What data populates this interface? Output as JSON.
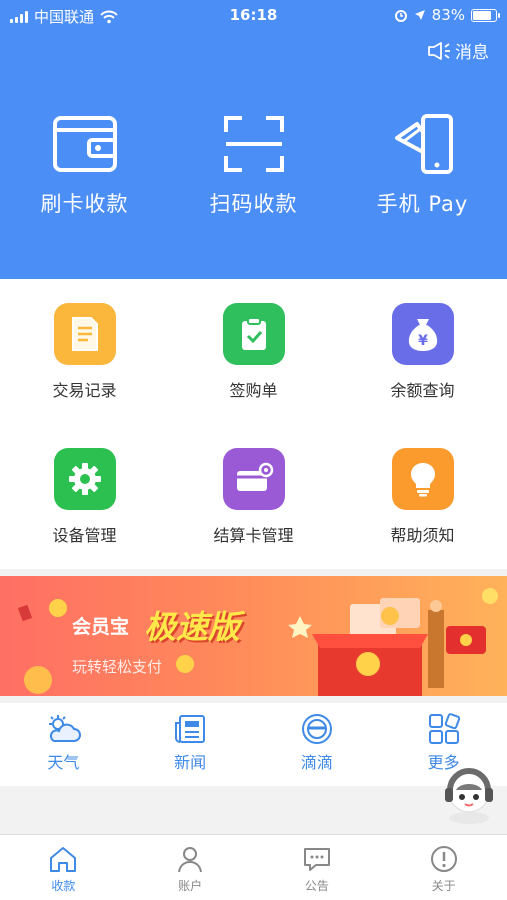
{
  "status_bar": {
    "carrier": "中国联通",
    "time": "16:18",
    "battery": "83%"
  },
  "header": {
    "message_label": "消息"
  },
  "hero_actions": [
    {
      "label": "刷卡收款",
      "icon": "wallet-icon"
    },
    {
      "label": "扫码收款",
      "icon": "scan-icon"
    },
    {
      "label": "手机 Pay",
      "icon": "phone-pay-icon"
    }
  ],
  "grid": [
    {
      "label": "交易记录",
      "icon": "document-icon",
      "color": "#fbb63c"
    },
    {
      "label": "签购单",
      "icon": "clipboard-check-icon",
      "color": "#2fbf5c"
    },
    {
      "label": "余额查询",
      "icon": "money-bag-icon",
      "color": "#6a6de8"
    },
    {
      "label": "设备管理",
      "icon": "gear-icon",
      "color": "#2bc04f"
    },
    {
      "label": "结算卡管理",
      "icon": "card-settings-icon",
      "color": "#9a5ad6"
    },
    {
      "label": "帮助须知",
      "icon": "lightbulb-icon",
      "color": "#fb9a2d"
    }
  ],
  "banner": {
    "brand": "会员宝",
    "highlight": "极速版",
    "subtitle": "玩转轻松支付"
  },
  "quick_links": [
    {
      "label": "天气",
      "icon": "weather-icon"
    },
    {
      "label": "新闻",
      "icon": "news-icon"
    },
    {
      "label": "滴滴",
      "icon": "didi-icon"
    },
    {
      "label": "更多",
      "icon": "more-apps-icon"
    }
  ],
  "tabs": [
    {
      "label": "收款",
      "icon": "home-icon",
      "active": true
    },
    {
      "label": "账户",
      "icon": "user-icon",
      "active": false
    },
    {
      "label": "公告",
      "icon": "chat-icon",
      "active": false
    },
    {
      "label": "关于",
      "icon": "info-icon",
      "active": false
    }
  ],
  "colors": {
    "primary": "#4b8ef6",
    "tab_active": "#3f8ae6"
  }
}
